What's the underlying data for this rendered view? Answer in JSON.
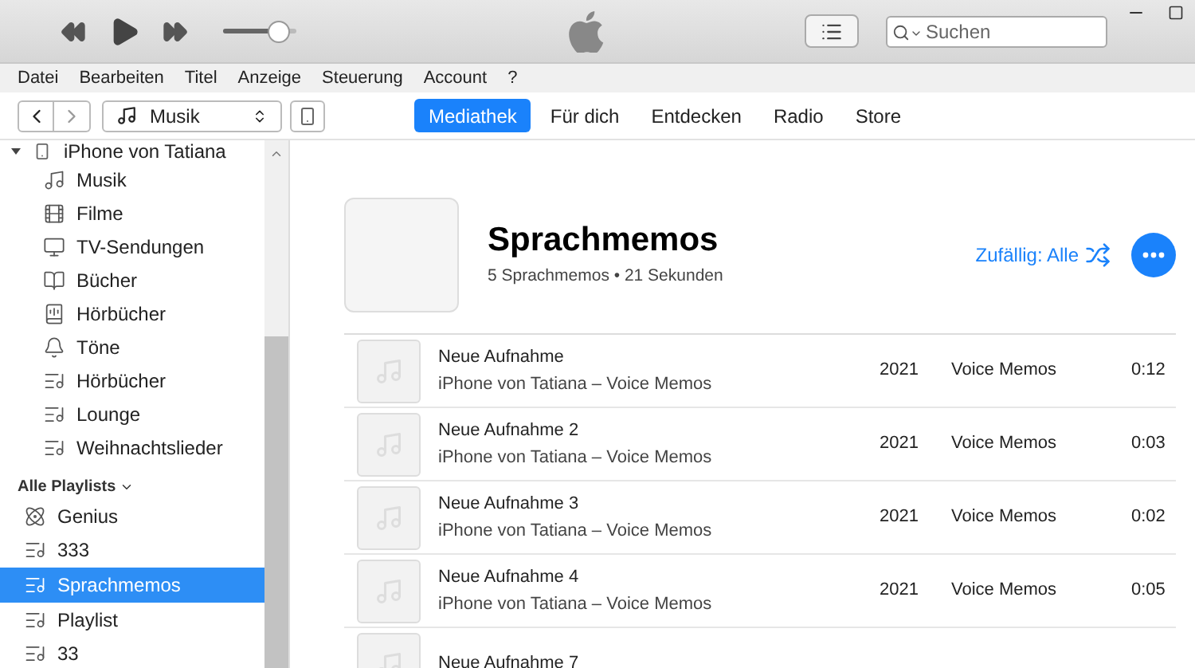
{
  "player": {
    "volume": {
      "level": 0.75
    }
  },
  "search": {
    "placeholder": "Suchen"
  },
  "menu": [
    "Datei",
    "Bearbeiten",
    "Titel",
    "Anzeige",
    "Steuerung",
    "Account",
    "?"
  ],
  "nav": {
    "source": "Musik",
    "tabs": [
      {
        "label": "Mediathek",
        "selected": true
      },
      {
        "label": "Für dich",
        "selected": false
      },
      {
        "label": "Entdecken",
        "selected": false
      },
      {
        "label": "Radio",
        "selected": false
      },
      {
        "label": "Store",
        "selected": false
      }
    ]
  },
  "sidebar": {
    "device": {
      "label": "iPhone von Tatiana",
      "expanded": true
    },
    "device_items": [
      {
        "kind": "music",
        "label": "Musik"
      },
      {
        "kind": "film",
        "label": "Filme"
      },
      {
        "kind": "tv",
        "label": "TV-Sendungen"
      },
      {
        "kind": "book",
        "label": "Bücher"
      },
      {
        "kind": "audiobook",
        "label": "Hörbücher"
      },
      {
        "kind": "bell",
        "label": "Töne"
      },
      {
        "kind": "playlist",
        "label": "Hörbücher"
      },
      {
        "kind": "playlist",
        "label": "Lounge"
      },
      {
        "kind": "playlist",
        "label": "Weihnachtslieder"
      }
    ],
    "section": "Alle Playlists",
    "playlists": [
      {
        "kind": "genius",
        "label": "Genius",
        "selected": false
      },
      {
        "kind": "playlist",
        "label": "333",
        "selected": false
      },
      {
        "kind": "playlist",
        "label": "Sprachmemos",
        "selected": true
      },
      {
        "kind": "playlist",
        "label": "Playlist",
        "selected": false
      },
      {
        "kind": "playlist",
        "label": "33",
        "selected": false
      }
    ]
  },
  "playlist": {
    "title": "Sprachmemos",
    "subtitle": "5 Sprachmemos • 21 Sekunden",
    "shuffle": "Zufällig: Alle"
  },
  "tracks": [
    {
      "title": "Neue Aufnahme",
      "artist": "iPhone von Tatiana – Voice Memos",
      "year": "2021",
      "genre": "Voice Memos",
      "time": "0:12"
    },
    {
      "title": "Neue Aufnahme 2",
      "artist": "iPhone von Tatiana – Voice Memos",
      "year": "2021",
      "genre": "Voice Memos",
      "time": "0:03"
    },
    {
      "title": "Neue Aufnahme 3",
      "artist": "iPhone von Tatiana – Voice Memos",
      "year": "2021",
      "genre": "Voice Memos",
      "time": "0:02"
    },
    {
      "title": "Neue Aufnahme 4",
      "artist": "iPhone von Tatiana – Voice Memos",
      "year": "2021",
      "genre": "Voice Memos",
      "time": "0:05"
    },
    {
      "title": "Neue Aufnahme 7"
    }
  ]
}
